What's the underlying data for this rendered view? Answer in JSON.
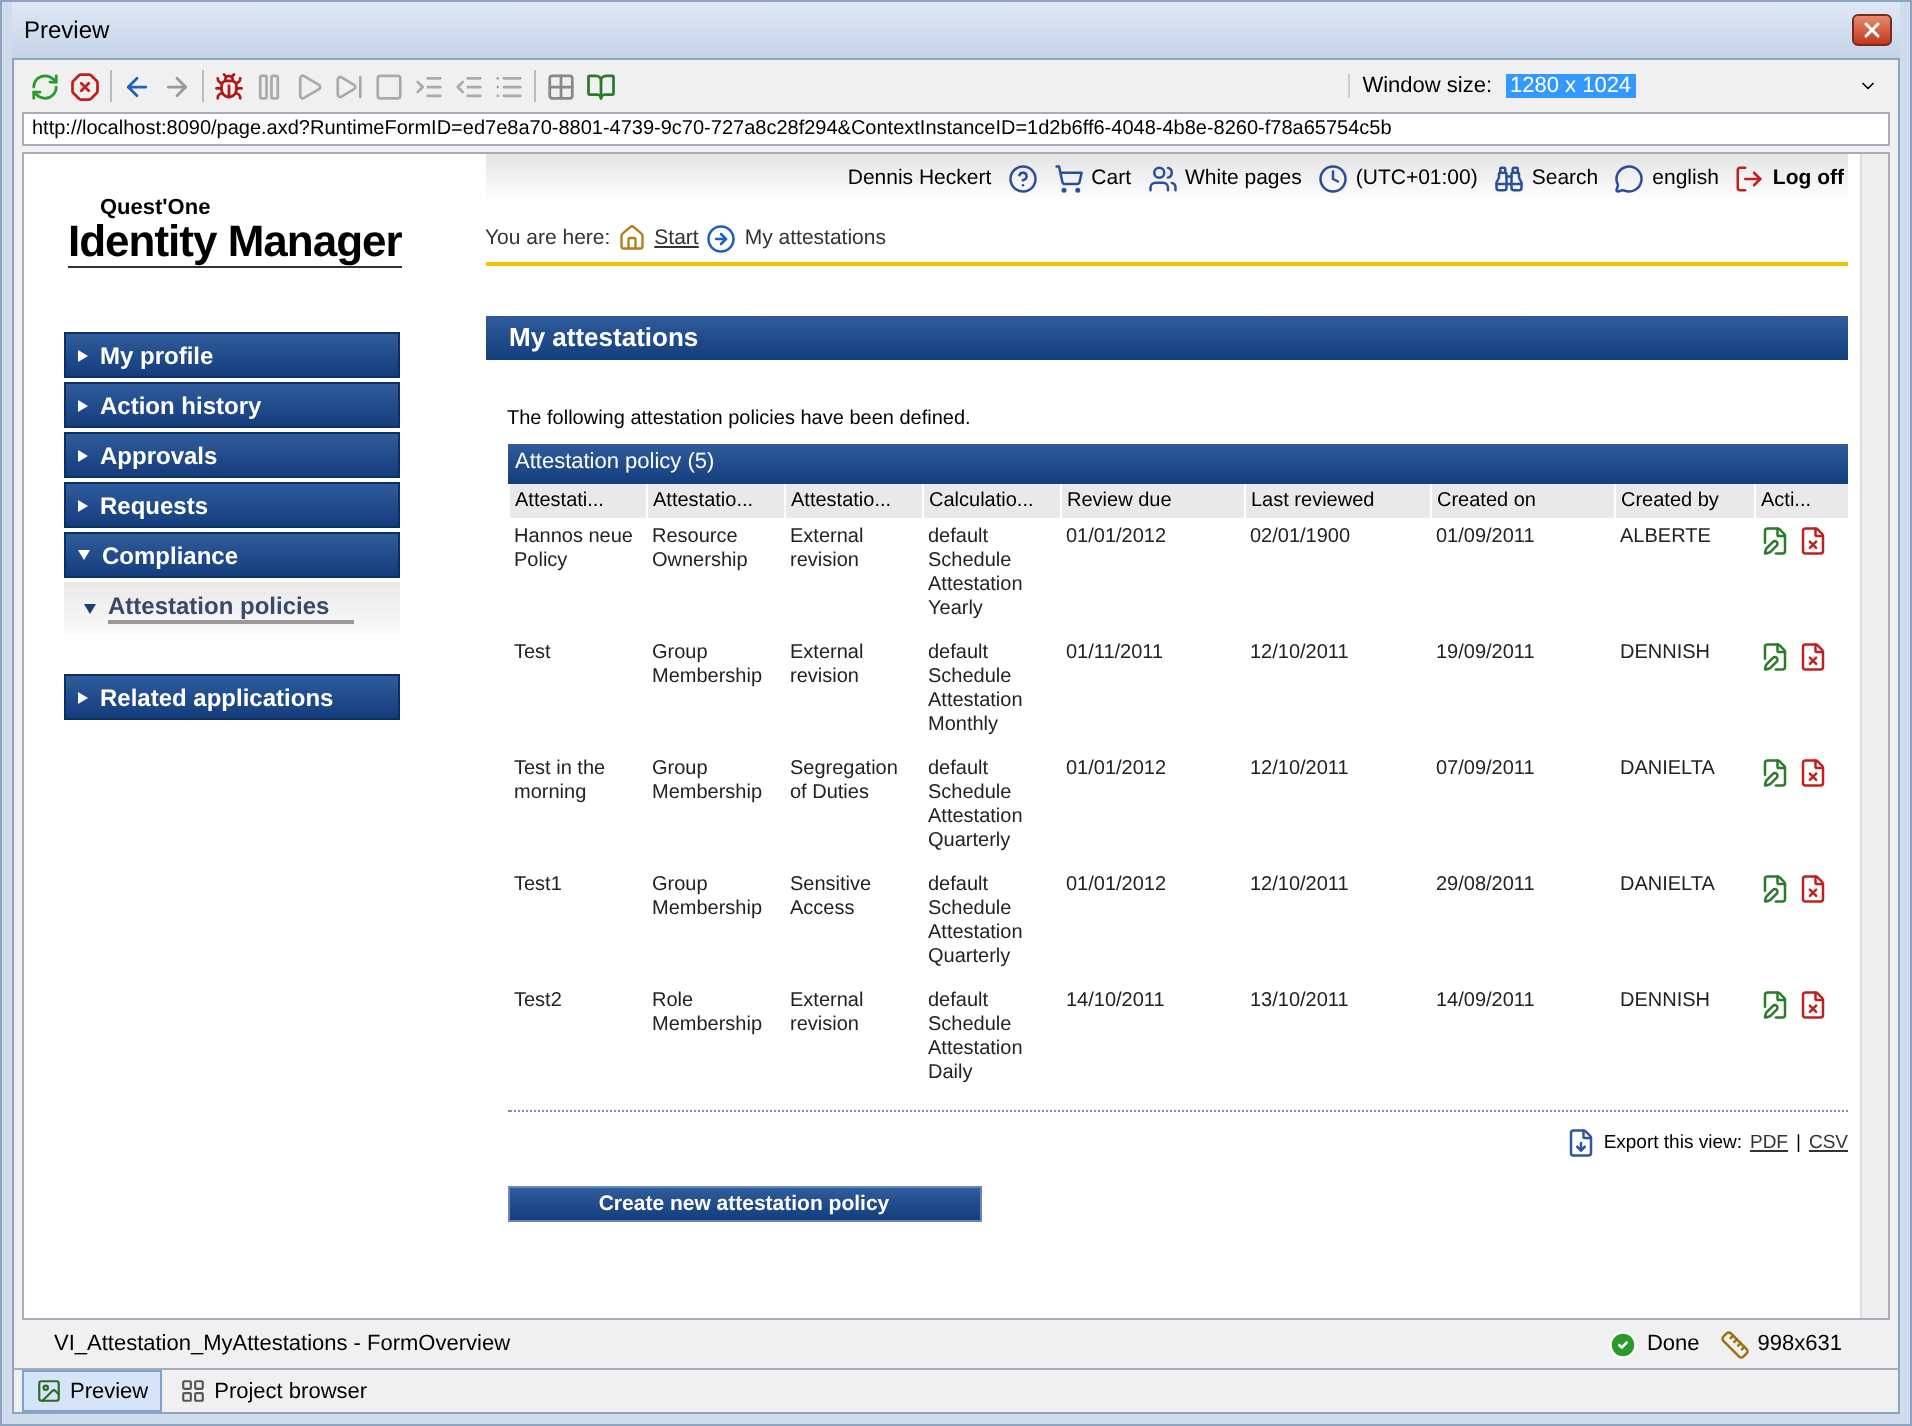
{
  "window": {
    "title": "Preview"
  },
  "toolbar": {
    "window_size_label": "Window size:",
    "window_size_value": "1280 x 1024"
  },
  "address": "http://localhost:8090/page.axd?RuntimeFormID=ed7e8a70-8801-4739-9c70-727a8c28f294&ContextInstanceID=1d2b6ff6-4048-4b8e-8260-f78a65754c5b",
  "logo": {
    "small": "Quest'One",
    "large": "Identity Manager"
  },
  "header_links": [
    {
      "kind": "user",
      "label": "Dennis Heckert"
    },
    {
      "kind": "help"
    },
    {
      "kind": "cart",
      "label": "Cart"
    },
    {
      "kind": "people",
      "label": "White pages"
    },
    {
      "kind": "clock",
      "label": "(UTC+01:00)"
    },
    {
      "kind": "search",
      "label": "Search"
    },
    {
      "kind": "language",
      "label": "english"
    },
    {
      "kind": "logoff",
      "label": "Log off"
    }
  ],
  "breadcrumb": {
    "label": "You are here:",
    "items": [
      "Start",
      "My attestations"
    ]
  },
  "sidebar": {
    "items": [
      {
        "label": "My profile",
        "expanded": false
      },
      {
        "label": "Action history",
        "expanded": false
      },
      {
        "label": "Approvals",
        "expanded": false
      },
      {
        "label": "Requests",
        "expanded": false
      },
      {
        "label": "Compliance",
        "expanded": true,
        "children": [
          {
            "label": "Attestation policies",
            "selected": true
          }
        ]
      },
      {
        "label": "Related applications",
        "expanded": false
      }
    ]
  },
  "page_title": "My attestations",
  "intro": "The following attestation policies have been defined.",
  "table": {
    "title": "Attestation policy (5)",
    "columns": [
      "Attestati...",
      "Attestatio...",
      "Attestatio...",
      "Calculatio...",
      "Review due",
      "Last reviewed",
      "Created on",
      "Created by",
      "Acti..."
    ],
    "rows": [
      [
        "Hannos neue Policy",
        "Resource Ownership",
        "External revision",
        "default Schedule Attestation Yearly",
        "01/01/2012",
        "02/01/1900",
        "01/09/2011",
        "ALBERTE"
      ],
      [
        "Test",
        "Group Membership",
        "External revision",
        "default Schedule Attestation Monthly",
        "01/11/2011",
        "12/10/2011",
        "19/09/2011",
        "DENNISH"
      ],
      [
        "Test in the morning",
        "Group Membership",
        "Segregation of Duties",
        "default Schedule Attestation Quarterly",
        "01/01/2012",
        "12/10/2011",
        "07/09/2011",
        "DANIELTA"
      ],
      [
        "Test1",
        "Group Membership",
        "Sensitive Access",
        "default Schedule Attestation Quarterly",
        "01/01/2012",
        "12/10/2011",
        "29/08/2011",
        "DANIELTA"
      ],
      [
        "Test2",
        "Role Membership",
        "External revision",
        "default Schedule Attestation Daily",
        "14/10/2011",
        "13/10/2011",
        "14/09/2011",
        "DENNISH"
      ]
    ]
  },
  "export": {
    "label": "Export this view:",
    "links": [
      "PDF",
      "CSV"
    ],
    "separator": "|"
  },
  "create_button": "Create new attestation policy",
  "status_bar": {
    "form": "VI_Attestation_MyAttestations - FormOverview",
    "state": "Done",
    "size": "998x631"
  },
  "bottom_tabs": [
    {
      "label": "Preview",
      "selected": true
    },
    {
      "label": "Project browser",
      "selected": false
    }
  ]
}
